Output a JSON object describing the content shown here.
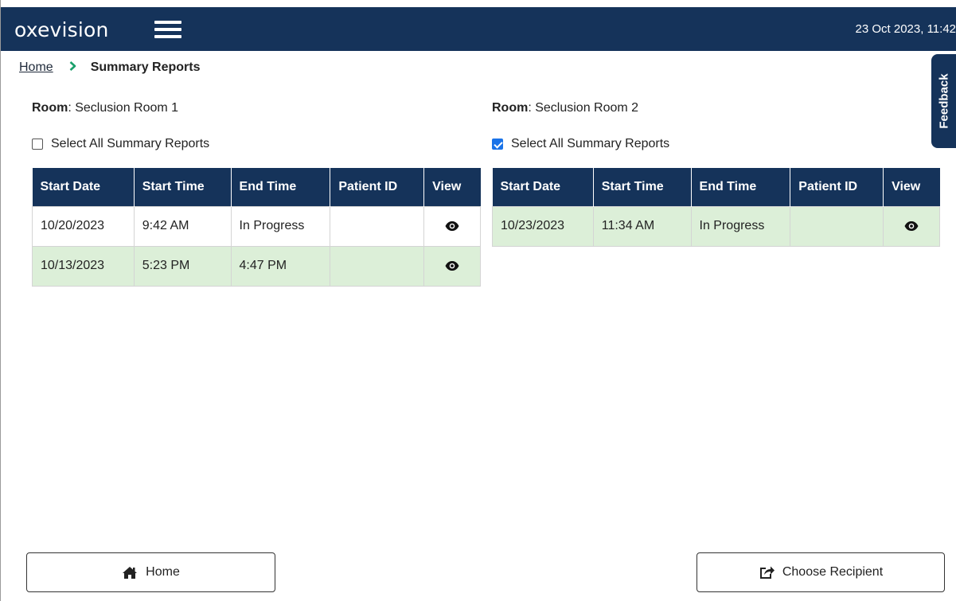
{
  "header": {
    "logo": "oxevision",
    "datetime": "23 Oct 2023, 11:42"
  },
  "breadcrumb": {
    "home": "Home",
    "current": "Summary Reports"
  },
  "feedback_label": "Feedback",
  "rooms": [
    {
      "label_key": "Room",
      "label_value": ": Seclusion Room 1",
      "select_all_label": "Select All Summary Reports",
      "select_all_checked": false,
      "columns": [
        "Start Date",
        "Start Time",
        "End Time",
        "Patient ID",
        "View"
      ],
      "rows": [
        {
          "start_date": "10/20/2023",
          "start_time": "9:42 AM",
          "end_time": "In Progress",
          "patient_id": "",
          "view_icon": "eye-icon"
        },
        {
          "start_date": "10/13/2023",
          "start_time": "5:23 PM",
          "end_time": "4:47 PM",
          "patient_id": "",
          "view_icon": "eye-icon"
        }
      ]
    },
    {
      "label_key": "Room",
      "label_value": ": Seclusion Room 2",
      "select_all_label": "Select All Summary Reports",
      "select_all_checked": true,
      "columns": [
        "Start Date",
        "Start Time",
        "End Time",
        "Patient ID",
        "View"
      ],
      "rows": [
        {
          "start_date": "10/23/2023",
          "start_time": "11:34 AM",
          "end_time": "In Progress",
          "patient_id": "",
          "view_icon": "eye-icon"
        }
      ]
    }
  ],
  "footer": {
    "home_button": "Home",
    "home_icon": "home-icon",
    "choose_recipient_button": "Choose Recipient",
    "choose_recipient_icon": "share-icon"
  },
  "colors": {
    "header_bg": "#15335a",
    "accent_green": "#1aa06b",
    "row_highlight": "#dcefd8",
    "checkbox_blue": "#1a73e8"
  }
}
